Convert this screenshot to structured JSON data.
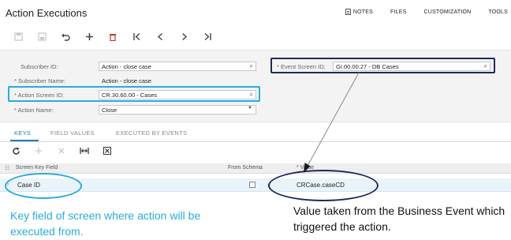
{
  "window": {
    "title": "Action Executions"
  },
  "topbar": {
    "notes": "NOTES",
    "files": "FILES",
    "customization": "CUSTOMIZATION",
    "tools": "TOOLS"
  },
  "form": {
    "subscriber_id_label": "Subscriber ID:",
    "subscriber_id_value": "Action - close case",
    "subscriber_name_label": "Subscriber Name:",
    "subscriber_name_value": "Action - close case",
    "action_screen_id_label": "Action Screen ID:",
    "action_screen_id_value": "CR.30.60.00 - Cases",
    "action_name_label": "Action Name:",
    "action_name_value": "Close",
    "event_screen_id_label": "Event Screen ID:",
    "event_screen_id_value": "GI.00.00.27 - DB Cases"
  },
  "tabs": [
    {
      "label": "KEYS",
      "active": true
    },
    {
      "label": "FIELD VALUES",
      "active": false
    },
    {
      "label": "EXECUTED BY EVENTS",
      "active": false
    }
  ],
  "grid": {
    "columns": [
      "Screen Key Field",
      "From Schema",
      "Value"
    ],
    "rows": [
      {
        "key_field": "Case ID",
        "from_schema": false,
        "value": "CRCase.caseCD"
      }
    ]
  },
  "annotations": {
    "key_note": "Key field of screen where action will be executed from.",
    "value_note": "Value taken from the Business Event which triggered the action."
  },
  "colors": {
    "accent_blue": "#29abe2",
    "accent_navy": "#1f2a5c",
    "tab_active": "#1f7bb6",
    "row_selected": "#e9f3fa"
  }
}
